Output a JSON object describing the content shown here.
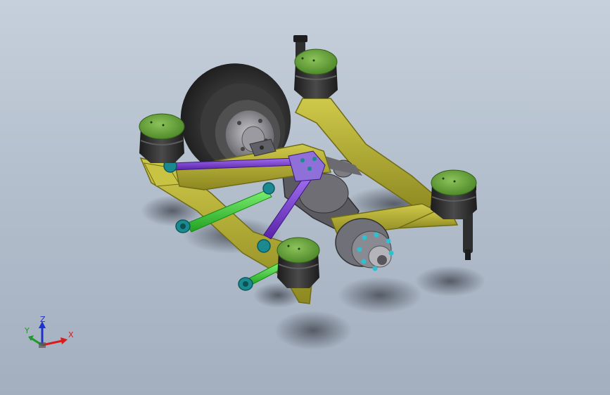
{
  "viewport": {
    "background_top": "#c6d0dc",
    "background_bottom": "#a3afbf"
  },
  "model": {
    "frame_color": "#a9a42a",
    "airbag_top_color": "#6aa33a",
    "airbag_body_color": "#2c2c2c",
    "upper_link_color": "#7a3cc8",
    "lower_link_color": "#38c233",
    "bushing_color": "#1b8a90",
    "tire_color": "#2a2a2a",
    "hub_color": "#8c8c90"
  },
  "triad": {
    "x_label": "X",
    "y_label": "Y",
    "z_label": "Z",
    "x_color": "#d81c1c",
    "y_color": "#1e9a2a",
    "z_color": "#1c32c8",
    "icon": "coordinate-triad-icon"
  }
}
